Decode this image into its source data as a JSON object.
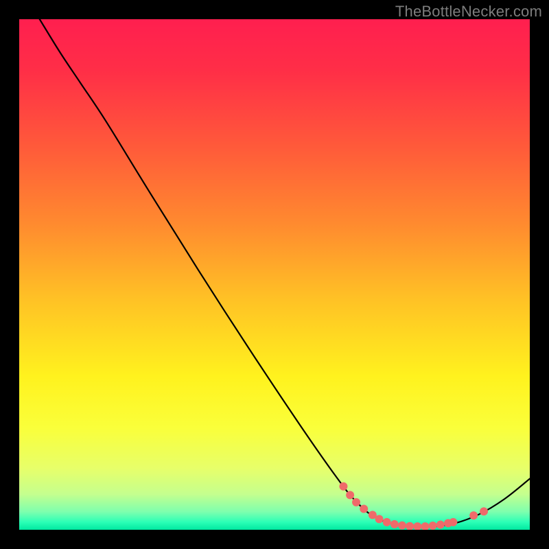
{
  "watermark": "TheBottleNecker.com",
  "chart_data": {
    "type": "line",
    "title": "",
    "xlabel": "",
    "ylabel": "",
    "x_range": [
      0,
      100
    ],
    "y_range": [
      0,
      100
    ],
    "gradient_stops": [
      {
        "offset": 0.0,
        "color": "#ff1f4f"
      },
      {
        "offset": 0.1,
        "color": "#ff2e47"
      },
      {
        "offset": 0.25,
        "color": "#ff5a3a"
      },
      {
        "offset": 0.4,
        "color": "#ff8a2f"
      },
      {
        "offset": 0.55,
        "color": "#ffc225"
      },
      {
        "offset": 0.7,
        "color": "#fff21e"
      },
      {
        "offset": 0.8,
        "color": "#faff3a"
      },
      {
        "offset": 0.88,
        "color": "#e7ff6a"
      },
      {
        "offset": 0.93,
        "color": "#c5ff8e"
      },
      {
        "offset": 0.965,
        "color": "#7dffae"
      },
      {
        "offset": 0.985,
        "color": "#2bffb6"
      },
      {
        "offset": 1.0,
        "color": "#00e8a0"
      }
    ],
    "series": [
      {
        "name": "curve",
        "style": "line",
        "points": [
          {
            "x": 4.0,
            "y": 100.0
          },
          {
            "x": 8.0,
            "y": 93.5
          },
          {
            "x": 12.0,
            "y": 87.5
          },
          {
            "x": 17.0,
            "y": 80.0
          },
          {
            "x": 25.0,
            "y": 67.0
          },
          {
            "x": 35.0,
            "y": 51.0
          },
          {
            "x": 45.0,
            "y": 35.5
          },
          {
            "x": 55.0,
            "y": 20.5
          },
          {
            "x": 62.0,
            "y": 10.5
          },
          {
            "x": 66.0,
            "y": 5.5
          },
          {
            "x": 70.0,
            "y": 2.3
          },
          {
            "x": 75.0,
            "y": 0.8
          },
          {
            "x": 80.0,
            "y": 0.6
          },
          {
            "x": 85.0,
            "y": 1.2
          },
          {
            "x": 90.0,
            "y": 3.0
          },
          {
            "x": 95.0,
            "y": 6.0
          },
          {
            "x": 100.0,
            "y": 10.0
          }
        ]
      },
      {
        "name": "markers",
        "style": "dots",
        "approx_note": "salmon dot markers clustered at valley and right slope",
        "points": [
          {
            "x": 63.5,
            "y": 8.5
          },
          {
            "x": 64.8,
            "y": 6.8
          },
          {
            "x": 66.0,
            "y": 5.4
          },
          {
            "x": 67.5,
            "y": 4.1
          },
          {
            "x": 69.2,
            "y": 2.9
          },
          {
            "x": 70.5,
            "y": 2.1
          },
          {
            "x": 72.0,
            "y": 1.5
          },
          {
            "x": 73.5,
            "y": 1.1
          },
          {
            "x": 75.0,
            "y": 0.85
          },
          {
            "x": 76.5,
            "y": 0.7
          },
          {
            "x": 78.0,
            "y": 0.65
          },
          {
            "x": 79.5,
            "y": 0.65
          },
          {
            "x": 81.0,
            "y": 0.8
          },
          {
            "x": 82.5,
            "y": 1.0
          },
          {
            "x": 84.0,
            "y": 1.3
          },
          {
            "x": 85.0,
            "y": 1.5
          },
          {
            "x": 89.0,
            "y": 2.8
          },
          {
            "x": 91.0,
            "y": 3.6
          }
        ]
      }
    ]
  }
}
